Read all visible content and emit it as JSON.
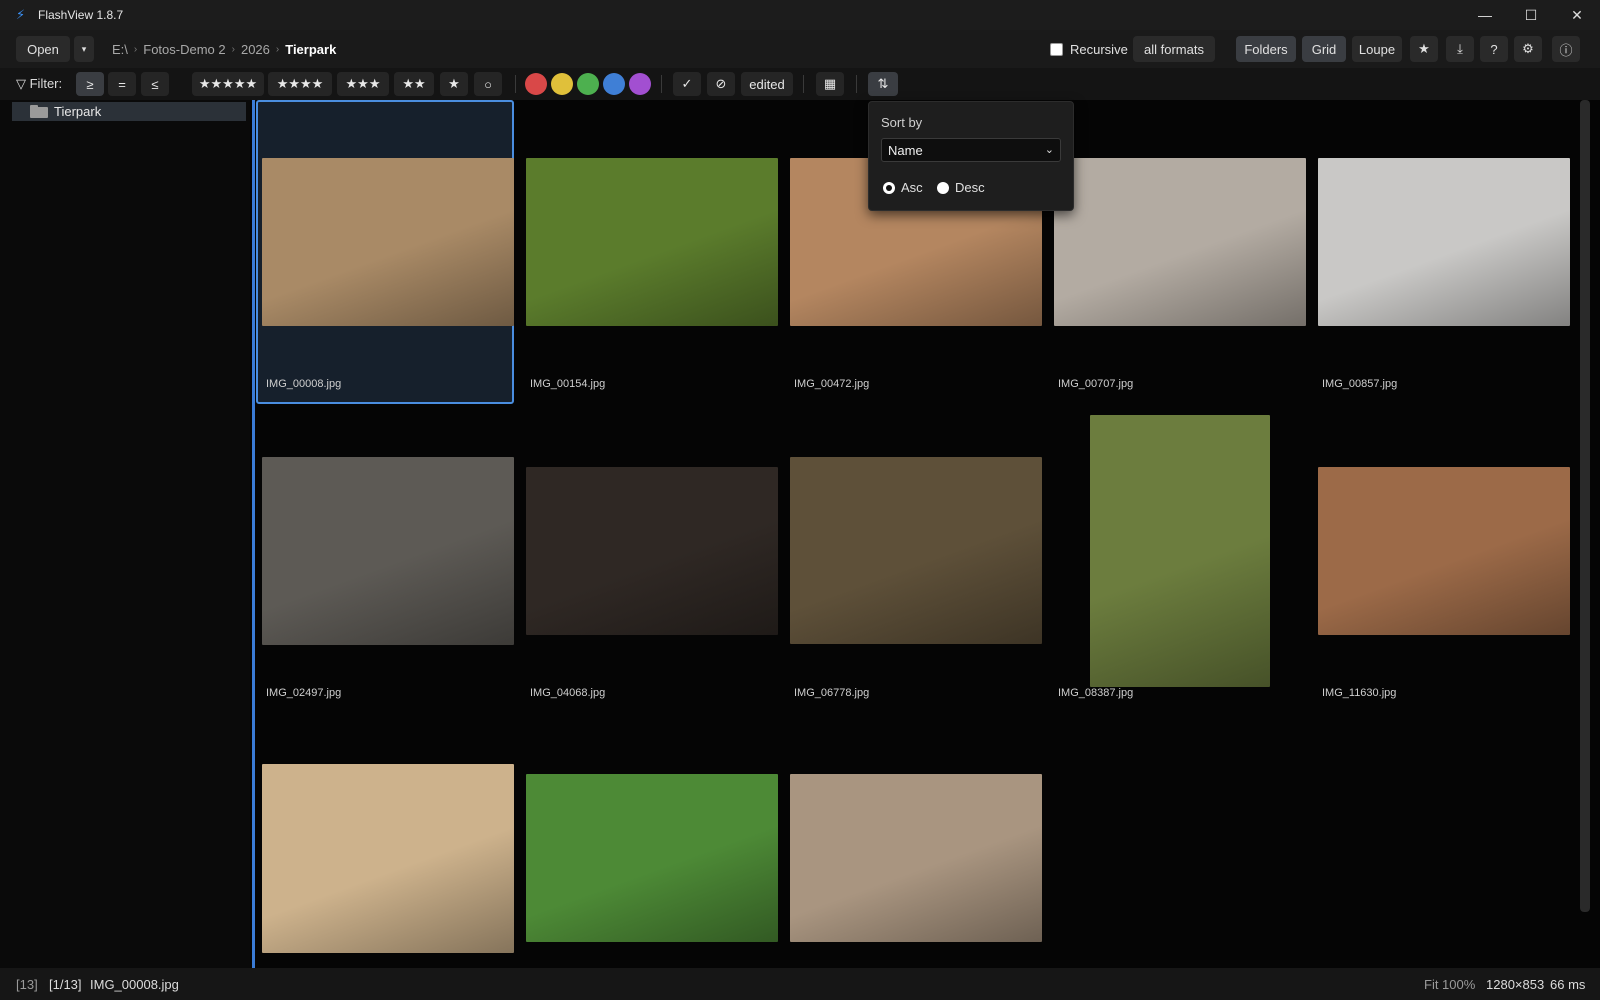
{
  "window": {
    "app_icon": "lightning-icon",
    "title": "FlashView 1.8.7",
    "minimize_glyph": "—",
    "maximize_glyph": "☐",
    "close_glyph": "✕"
  },
  "toolbar": {
    "open_label": "Open",
    "open_caret": "▾",
    "breadcrumb": [
      "E:\\",
      "Fotos-Demo 2",
      "2026",
      "Tierpark"
    ],
    "breadcrumb_sep": "›",
    "recursive_label": "Recursive",
    "recursive_checked": false,
    "formats_label": "all formats",
    "folders_label": "Folders",
    "grid_label": "Grid",
    "loupe_label": "Loupe",
    "star_glyph": "★",
    "download_glyph": "⤓",
    "help_glyph": "?",
    "settings_glyph": "⚙",
    "info_glyph": "ⓘ"
  },
  "filter": {
    "label": "▽ Filter:",
    "gte": "≥",
    "eq": "=",
    "lte": "≤",
    "stars5": "★★★★★",
    "stars4": "★★★★",
    "stars3": "★★★",
    "stars2": "★★",
    "stars1": "★",
    "unrated": "○",
    "colors": [
      "#d94848",
      "#e0c03a",
      "#4db04f",
      "#3f7fd6",
      "#a24fd1"
    ],
    "picked": "✓",
    "rejected": "⊘",
    "edited": "edited",
    "calendar_glyph": "▦",
    "sort_glyph": "⇅"
  },
  "sidebar": {
    "folder": "Tierpark"
  },
  "sort_popup": {
    "title": "Sort by",
    "selected": "Name",
    "caret": "⌄",
    "asc_label": "Asc",
    "desc_label": "Desc",
    "asc_checked": true
  },
  "thumbnails": [
    {
      "file": "IMG_00008.jpg",
      "color": "#a98a66",
      "selected": true
    },
    {
      "file": "IMG_00154.jpg",
      "color": "#5b7c2c"
    },
    {
      "file": "IMG_00472.jpg",
      "color": "#b48660"
    },
    {
      "file": "IMG_00707.jpg",
      "color": "#b3aba2"
    },
    {
      "file": "IMG_00857.jpg",
      "color": "#c9c8c6"
    },
    {
      "file": "IMG_02497.jpg",
      "color": "#5d5a55"
    },
    {
      "file": "IMG_04068.jpg",
      "color": "#2f2824"
    },
    {
      "file": "IMG_06778.jpg",
      "color": "#5e5039"
    },
    {
      "file": "IMG_08387.jpg",
      "color": "#6c7d3e"
    },
    {
      "file": "IMG_11630.jpg",
      "color": "#9c6a48"
    },
    {
      "file": "",
      "color": "#cdb28c"
    },
    {
      "file": "",
      "color": "#4d8a36"
    },
    {
      "file": "",
      "color": "#a99580"
    }
  ],
  "status": {
    "count": "[13]",
    "position": "[1/13]",
    "file": "IMG_00008.jpg",
    "fit": "Fit 100%",
    "dimensions": "1280×853",
    "time": "66 ms"
  }
}
